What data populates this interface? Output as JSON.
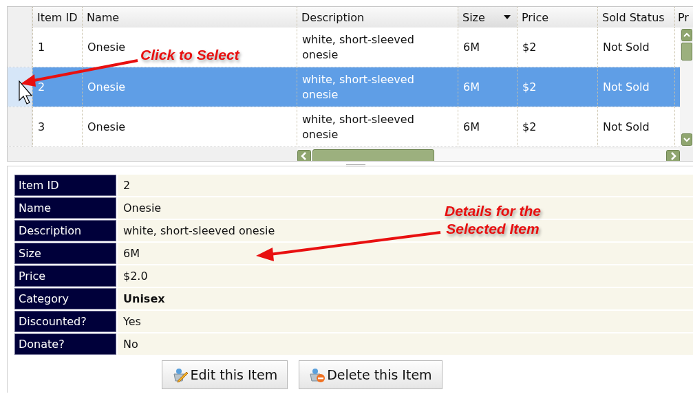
{
  "grid": {
    "columns": [
      {
        "label": "Item ID",
        "sorted": false
      },
      {
        "label": "Name",
        "sorted": false
      },
      {
        "label": "Description",
        "sorted": false
      },
      {
        "label": "Size",
        "sorted": true
      },
      {
        "label": "Price",
        "sorted": false
      },
      {
        "label": "Sold Status",
        "sorted": false
      },
      {
        "label": "Pr",
        "sorted": false
      }
    ],
    "rows": [
      {
        "selected": false,
        "cells": [
          "1",
          "Onesie",
          "white, short-sleeved onesie",
          "6M",
          "$2",
          "Not Sold"
        ]
      },
      {
        "selected": true,
        "cells": [
          "2",
          "Onesie",
          "white, short-sleeved onesie",
          "6M",
          "$2",
          "Not Sold"
        ]
      },
      {
        "selected": false,
        "cells": [
          "3",
          "Onesie",
          "white, short-sleeved onesie",
          "6M",
          "$2",
          "Not Sold"
        ]
      }
    ]
  },
  "details": [
    {
      "label": "Item ID",
      "value": "2",
      "bold": false
    },
    {
      "label": "Name",
      "value": "Onesie",
      "bold": false
    },
    {
      "label": "Description",
      "value": "white, short-sleeved onesie",
      "bold": false
    },
    {
      "label": "Size",
      "value": "6M",
      "bold": false
    },
    {
      "label": "Price",
      "value": "$2.0",
      "bold": false
    },
    {
      "label": "Category",
      "value": "Unisex",
      "bold": true
    },
    {
      "label": "Discounted?",
      "value": "Yes",
      "bold": false
    },
    {
      "label": "Donate?",
      "value": "No",
      "bold": false
    }
  ],
  "buttons": [
    {
      "label": "Edit this Item",
      "kind": "edit"
    },
    {
      "label": "Delete this Item",
      "kind": "delete"
    }
  ],
  "annotations": [
    {
      "text": "Click to Select"
    },
    {
      "text": "Details for the\nSelected Item"
    }
  ]
}
